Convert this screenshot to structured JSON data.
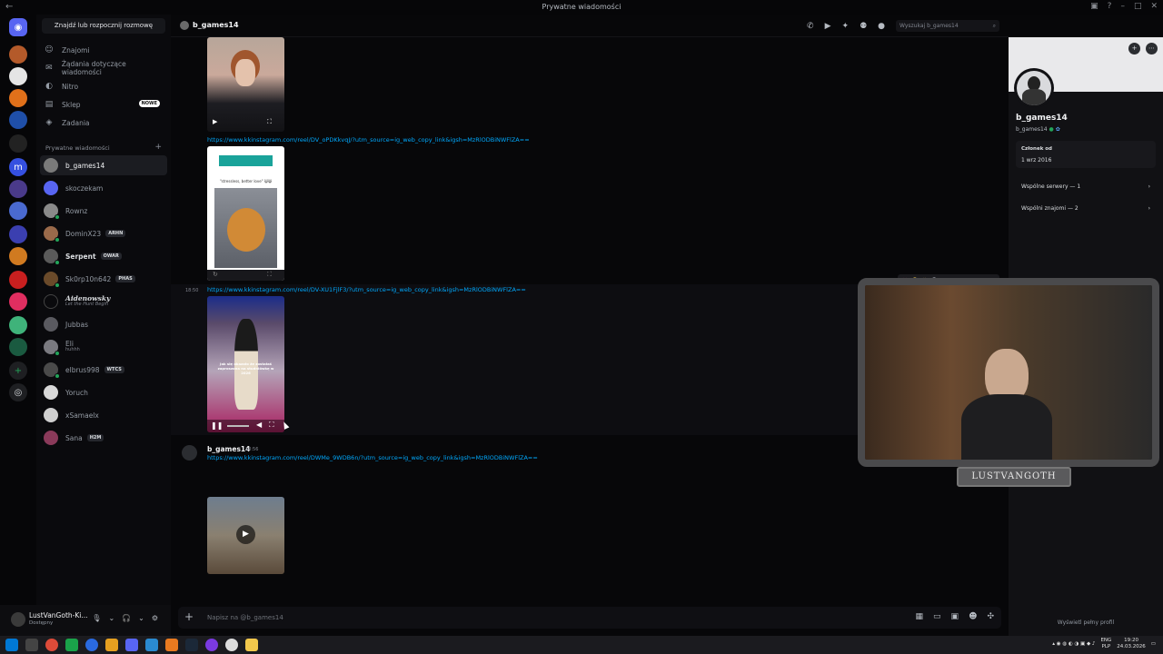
{
  "window": {
    "title": "Prywatne wiadomości"
  },
  "sidebar": {
    "search_button": "Znajdź lub rozpocznij rozmowę",
    "nav": [
      {
        "label": "Znajomi",
        "icon": "friends-icon"
      },
      {
        "label": "Żądania dotyczące wiadomości",
        "icon": "inbox-icon"
      },
      {
        "label": "Nitro",
        "icon": "nitro-icon"
      },
      {
        "label": "Sklep",
        "icon": "shop-icon",
        "badge": "NOWE"
      },
      {
        "label": "Zadania",
        "icon": "quests-icon"
      }
    ],
    "section_label": "Prywatne wiadomości",
    "dms": [
      {
        "name": "b_games14",
        "active": true
      },
      {
        "name": "skoczekam"
      },
      {
        "name": "Rownz"
      },
      {
        "name": "DominX23",
        "tag": "ARHN"
      },
      {
        "name": "Serpent",
        "tag": "OWAR"
      },
      {
        "name": "Sk0rp10n642",
        "tag": "PHAS"
      },
      {
        "name": "Aidenowsky",
        "sub": "Let the Hunt Begin"
      },
      {
        "name": "Jubbas"
      },
      {
        "name": "Eli",
        "sub": "huhhh"
      },
      {
        "name": "elbrus998",
        "tag": "WTCS"
      },
      {
        "name": "Yoruch"
      },
      {
        "name": "xSamaelx"
      },
      {
        "name": "Sana",
        "tag": "H2M"
      }
    ]
  },
  "user_panel": {
    "name": "LustVanGoth-Ki...",
    "status": "Dostępny"
  },
  "chat": {
    "recipient": "b_games14",
    "search_placeholder": "Wyszukaj b_games14",
    "messages": {
      "link1": "https://www.kkinstagram.com/reel/DV_oPDKkvqJ/?utm_source=ig_web_copy_link&igsh=MzRlODBiNWFlZA==",
      "link2": "https://www.kkinstagram.com/reel/DV-XU1FjlF3/?utm_source=ig_web_copy_link&igsh=MzRlODBiNWFlZA==",
      "time2": "18:50",
      "author": "b_games14",
      "author_time": "18:56",
      "link3": "https://www.kkinstagram.com/reel/DWMe_9WDB6n/?utm_source=ig_web_copy_link&igsh=MzRlODBiNWFlZA==",
      "video_caption_2": "\"stressless, better love\" 😺😸",
      "video_caption_3": "Jak się okazało że zostałaś zaproszona na studniówkę w 2026"
    },
    "composer_placeholder": "Napisz na @b_games14"
  },
  "profile": {
    "name": "b_games14",
    "username": "b_games14",
    "member_since_label": "Członek od",
    "member_since": "1 wrz 2016",
    "mutual_servers": "Wspólne serwery — 1",
    "mutual_friends": "Wspólni znajomi — 2",
    "footer": "Wyświetl pełny profil"
  },
  "overlay": {
    "webcam_label": "LUSTVANGOTH"
  },
  "taskbar": {
    "lang_top": "ENG",
    "lang_bottom": "PLP",
    "time": "19:20",
    "date": "24.03.2026"
  }
}
